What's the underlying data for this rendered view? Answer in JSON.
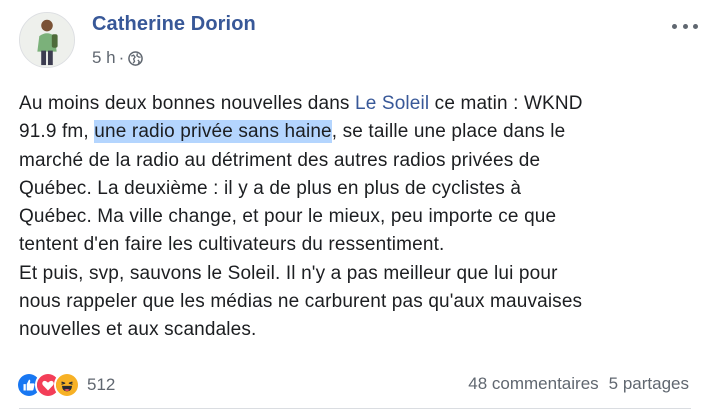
{
  "post": {
    "author": "Catherine Dorion",
    "time": "5 h",
    "separator": "·",
    "body": {
      "l1_a": "Au moins deux bonnes nouvelles dans ",
      "l1_link": "Le Soleil",
      "l1_b": " ce matin : WKND",
      "l2_a": "91.9 fm, ",
      "l2_hl": "une radio privée sans haine",
      "l2_b": ", se taille une place dans le",
      "l3": "marché de la radio au détriment des autres radios privées de",
      "l4": "Québec. La deuxième : il y a de plus en plus de cyclistes à",
      "l5": "Québec. Ma ville change, et pour le mieux, peu importe ce que",
      "l6": "tentent d'en faire les cultivateurs du ressentiment.",
      "l7": "Et puis, svp, sauvons le Soleil. Il n'y a pas meilleur que lui pour",
      "l8": "nous rappeler que les médias ne carburent pas qu'aux mauvaises",
      "l9": "nouvelles et aux scandales."
    },
    "reactions": {
      "count": "512",
      "types": [
        "like-icon",
        "love-icon",
        "haha-icon"
      ]
    },
    "comments": "48 commentaires",
    "shares": "5 partages"
  },
  "colors": {
    "link": "#385898",
    "meta": "#606770",
    "highlight": "#b4d5fe",
    "like": "#1877f2",
    "love": "#f33e58",
    "haha": "#f7b125"
  }
}
